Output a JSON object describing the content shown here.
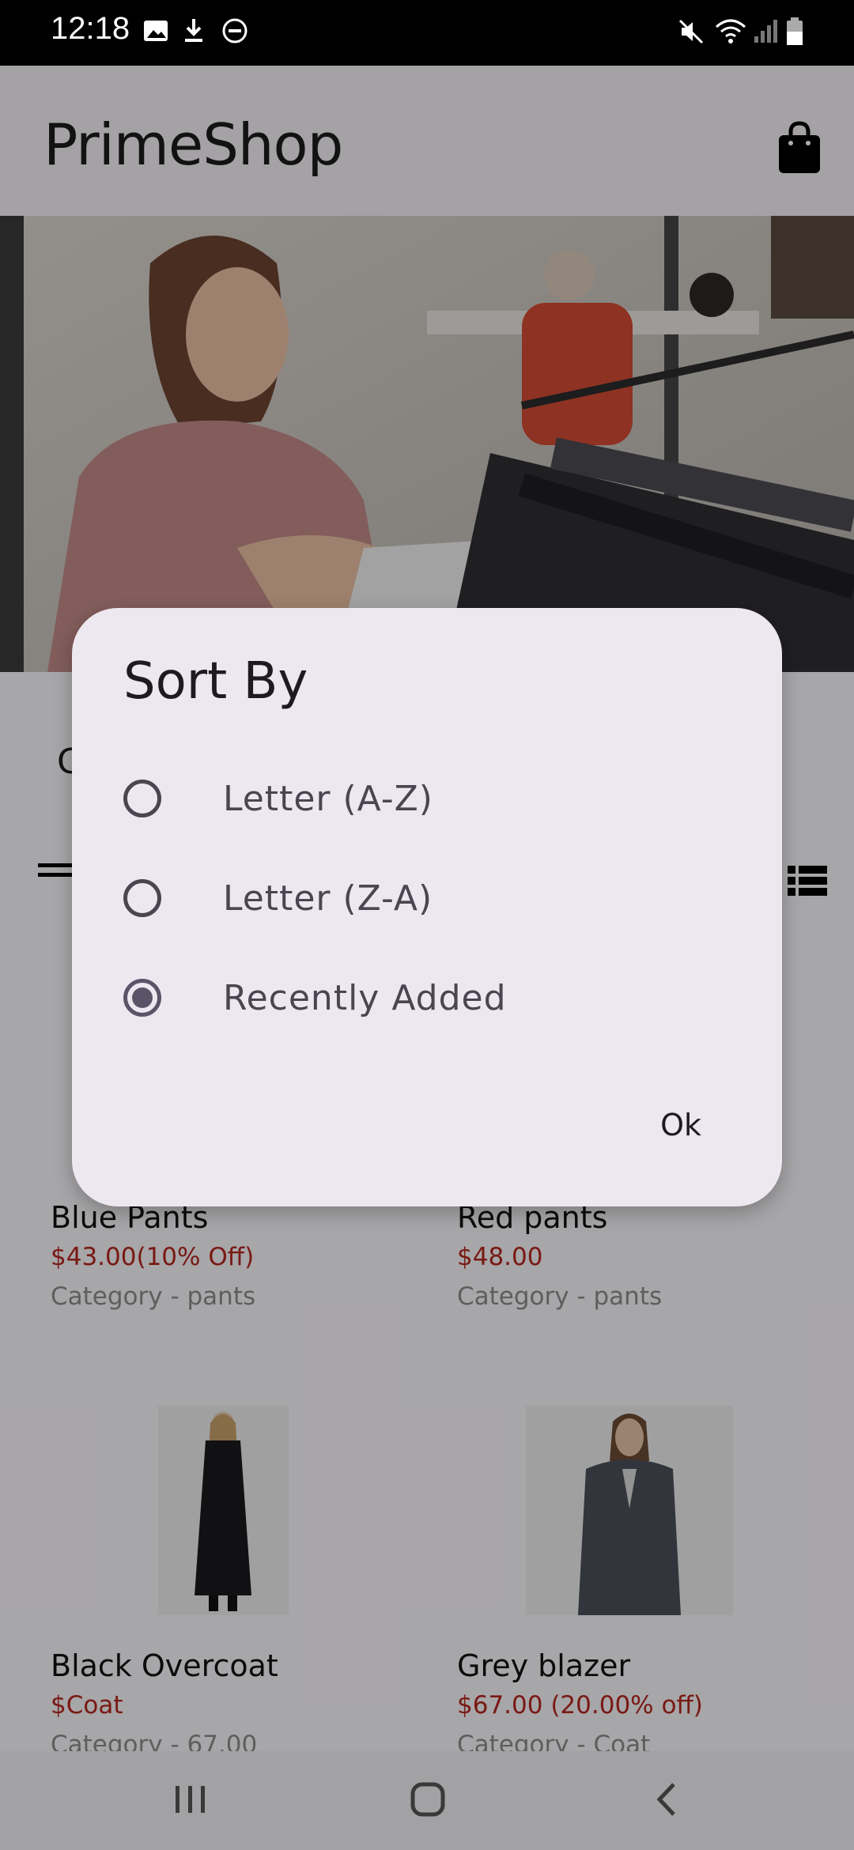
{
  "status_bar": {
    "time": "12:18",
    "icons": [
      "gallery-icon",
      "download-icon",
      "dnd-icon",
      "mute-icon",
      "wifi-icon",
      "signal-icon",
      "battery-icon"
    ]
  },
  "app_bar": {
    "title": "PrimeShop",
    "cart_icon": "shopping-bag-icon"
  },
  "products": [
    {
      "name": "Blue Pants",
      "price": "$43.00(10% Off)",
      "category": "Category - pants"
    },
    {
      "name": "Red pants",
      "price": "$48.00",
      "category": "Category - pants"
    },
    {
      "name": "Black Overcoat",
      "price": "$Coat",
      "category": "Category - 67.00"
    },
    {
      "name": "Grey blazer",
      "price": "$67.00 (20.00% off)",
      "category": "Category - Coat"
    }
  ],
  "dialog": {
    "title": "Sort By",
    "options": [
      {
        "label": "Letter (A-Z)",
        "selected": false
      },
      {
        "label": "Letter (Z-A)",
        "selected": false
      },
      {
        "label": "Recently Added",
        "selected": true
      }
    ],
    "ok_label": "Ok"
  },
  "colors": {
    "accent_price": "#b3261e",
    "dialog_bg": "#ede7f0",
    "radio": "#5b5468"
  }
}
